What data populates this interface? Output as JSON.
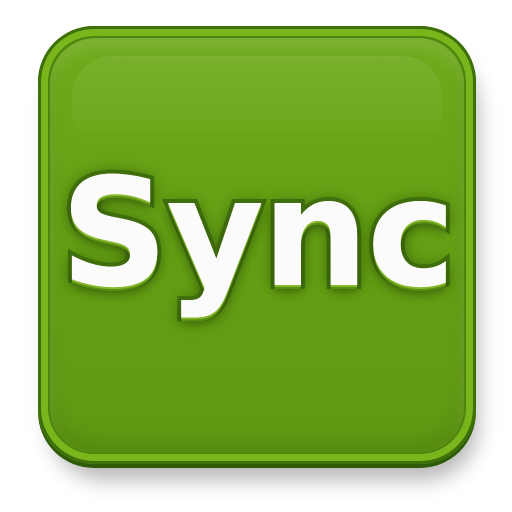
{
  "app_icon": {
    "label": "Sync",
    "accent_color": "#5f950f",
    "border_color": "#3d6f0a",
    "text_color": "#fbfbfb"
  }
}
